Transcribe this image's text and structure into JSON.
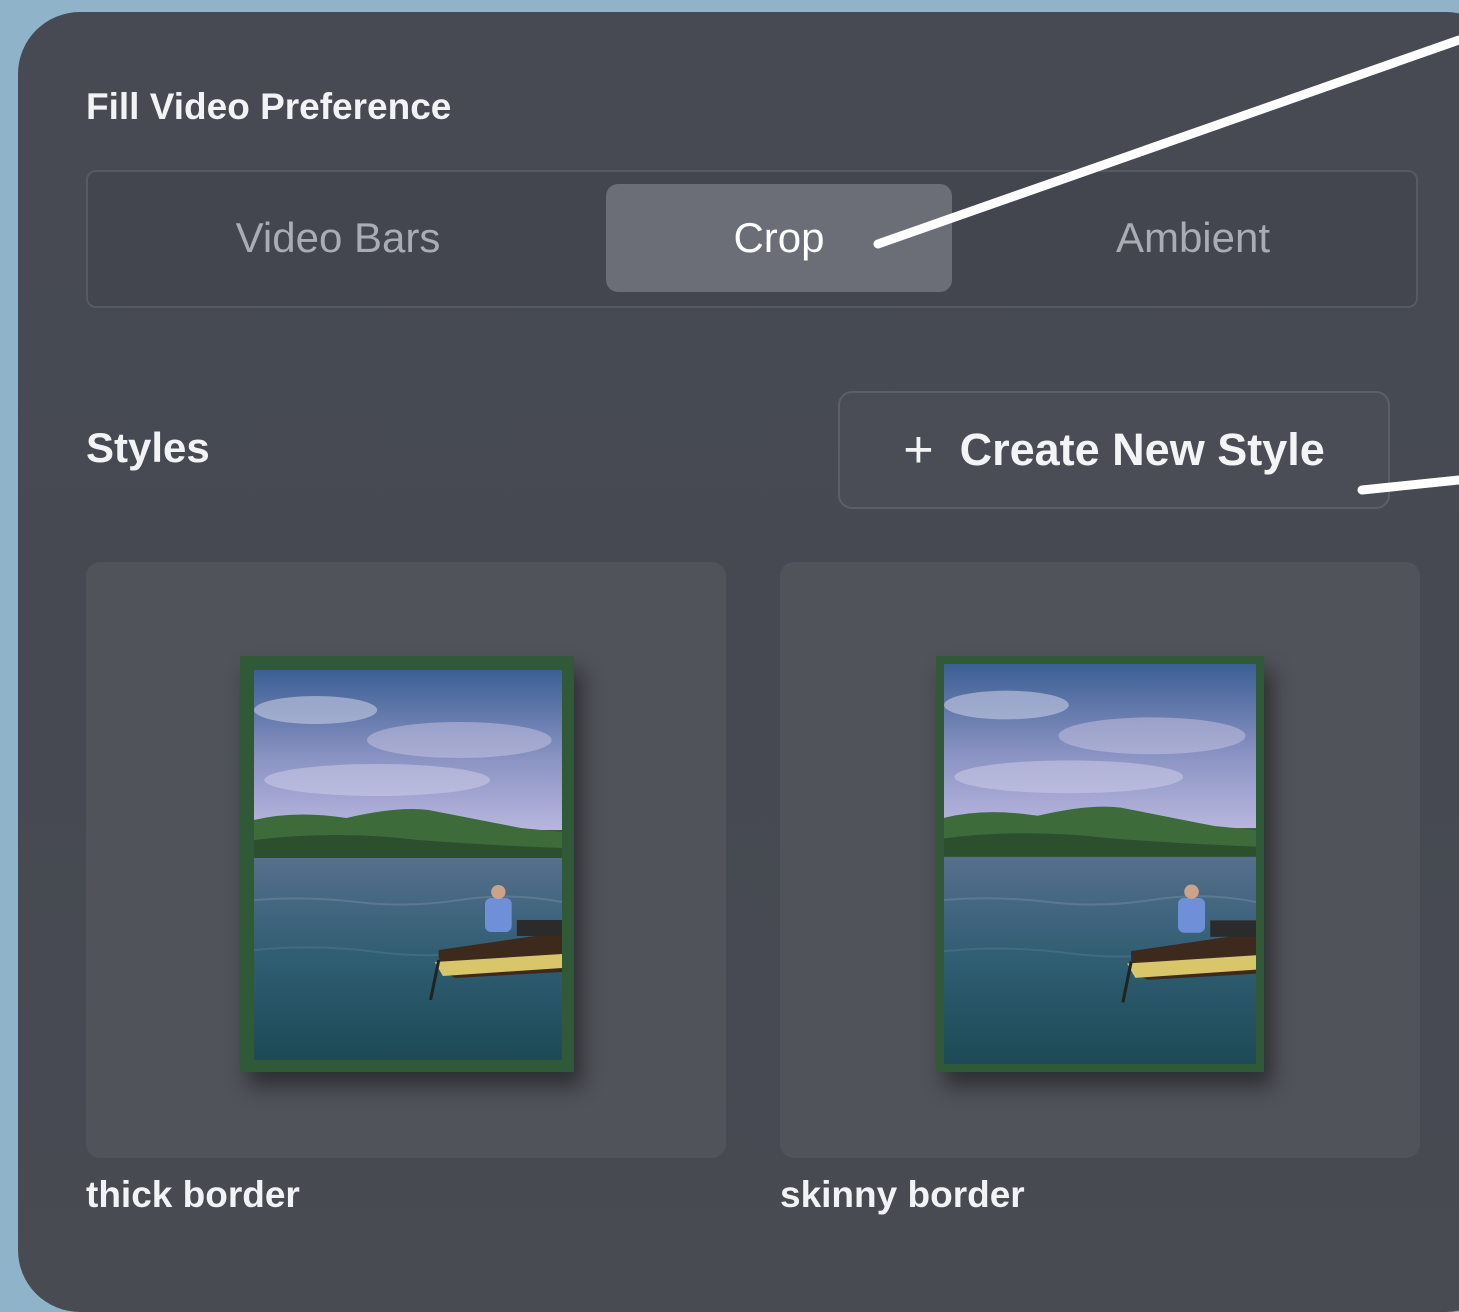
{
  "fill_video_preference": {
    "label": "Fill Video Preference",
    "options": [
      "Video Bars",
      "Crop",
      "Ambient"
    ],
    "selected": "Crop"
  },
  "styles": {
    "label": "Styles",
    "create_button": {
      "icon": "plus-icon",
      "label": "Create New Style"
    },
    "items": [
      {
        "name": "thick border",
        "border_color": "#2f5937"
      },
      {
        "name": "skinny border",
        "border_color": "#2f5937"
      }
    ]
  },
  "colors": {
    "background": "#8fb3c8",
    "panel": "#474a52",
    "selected_segment": "#6b6e76",
    "annotation_arrow": "#ffffff"
  }
}
